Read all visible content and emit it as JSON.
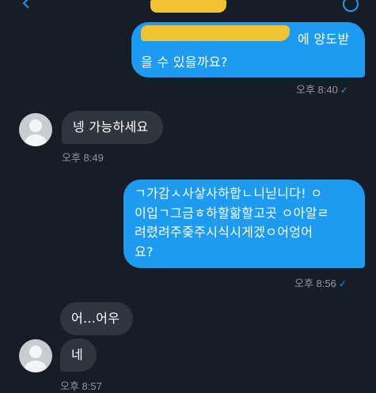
{
  "colors": {
    "background": "#161d27",
    "outgoing_bubble": "#1d9bf0",
    "incoming_bubble": "#2f3640",
    "timestamp": "#8b98a5",
    "redaction": "#f2c233"
  },
  "header": {
    "back_icon": "chevron-left-icon",
    "info_icon": "info-icon"
  },
  "messages": [
    {
      "direction": "out",
      "line1_visible": "에 양도받",
      "line2": "을 수 있을까요?",
      "time": "오후 8:40",
      "status": "✓"
    },
    {
      "direction": "in",
      "text": "넹 가능하세요",
      "time": "오후 8:49"
    },
    {
      "direction": "out",
      "text": "ㄱ가감ㅅ사샇사하합ㄴ니닏니다! ㅇ\n이입ㄱ그금ㅎ하할핢할고곳 ㅇ아알ㄹ\n려렸려주줒주시식시게겠ㅇ어엉어\n요?",
      "time": "오후 8:56",
      "status": "✓"
    },
    {
      "direction": "in",
      "text": "어...어우"
    },
    {
      "direction": "in",
      "text": "네",
      "time": "오후 8:57"
    }
  ]
}
